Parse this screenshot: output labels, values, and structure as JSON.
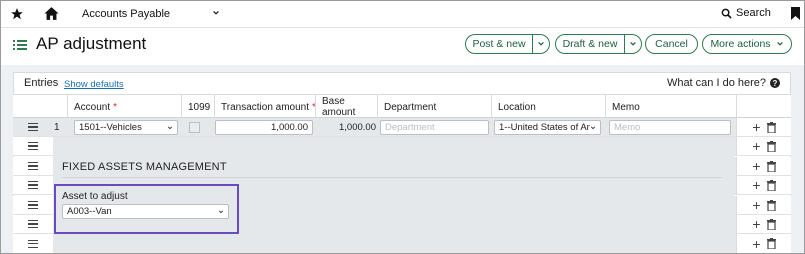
{
  "topbar": {
    "module": "Accounts Payable",
    "search_label": "Search"
  },
  "header": {
    "title": "AP adjustment",
    "buttons": {
      "post_new": "Post & new",
      "draft_new": "Draft & new",
      "cancel": "Cancel",
      "more_actions": "More actions"
    }
  },
  "entries": {
    "label": "Entries",
    "show_defaults": "Show defaults",
    "help": "What can I do here?",
    "columns": {
      "account": "Account",
      "col_1099": "1099",
      "transaction_amount": "Transaction amount",
      "base_amount": "Base amount",
      "department": "Department",
      "location": "Location",
      "memo": "Memo"
    },
    "row1": {
      "number": "1",
      "account": "1501--Vehicles",
      "transaction_amount": "1,000.00",
      "base_amount": "1,000.00",
      "department_placeholder": "Department",
      "location": "1--United States of Am",
      "memo_placeholder": "Memo"
    }
  },
  "fixed_assets": {
    "title": "FIXED ASSETS MANAGEMENT",
    "asset_label": "Asset to adjust",
    "asset_value": "A003--Van"
  },
  "colors": {
    "accent_green": "#2f7d4f",
    "highlight_purple": "#6a4bbd",
    "required_red": "#dd2233",
    "link_blue": "#1b6fb0"
  },
  "icons": [
    "star-icon",
    "home-icon",
    "chevron-down-icon",
    "search-icon",
    "bookmark-icon",
    "list-icon",
    "help-icon",
    "drag-handle-icon",
    "add-icon",
    "trash-icon"
  ]
}
